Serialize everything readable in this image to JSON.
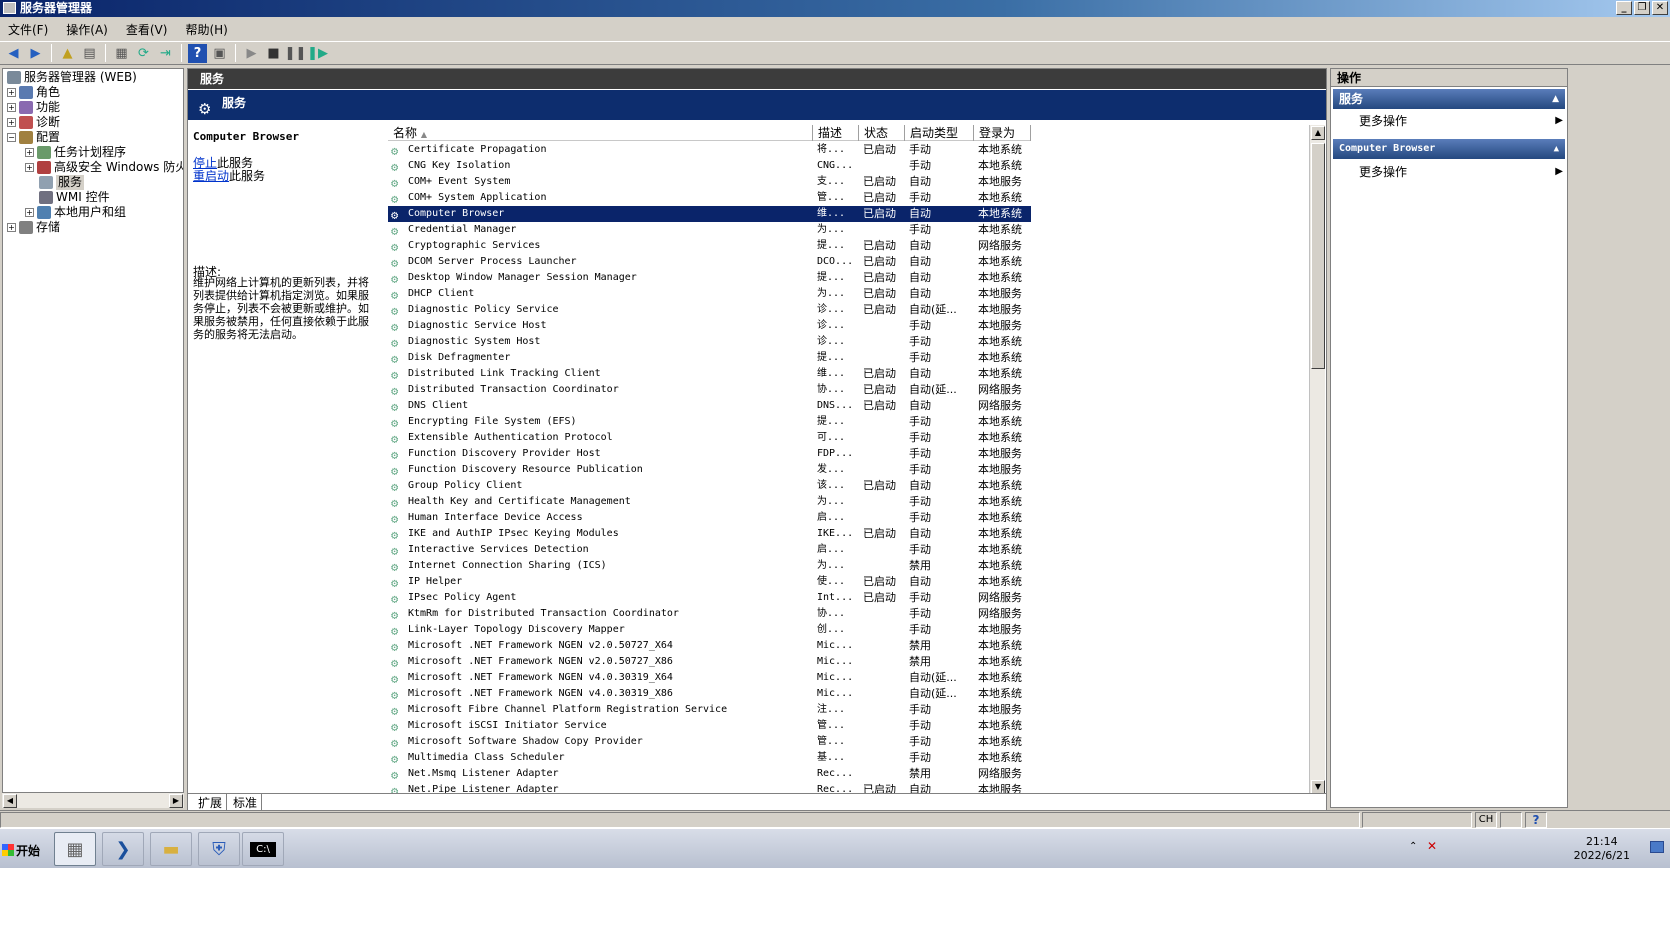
{
  "window": {
    "title": "服务器管理器",
    "buttons": [
      "_",
      "❐",
      "✕"
    ]
  },
  "menu": [
    "文件(F)",
    "操作(A)",
    "查看(V)",
    "帮助(H)"
  ],
  "tree": [
    {
      "label": "服务器管理器 (WEB)",
      "icon": "server-manager-icon",
      "level": 0,
      "expand": ""
    },
    {
      "label": "角色",
      "icon": "roles-icon",
      "level": 1,
      "expand": "+"
    },
    {
      "label": "功能",
      "icon": "features-icon",
      "level": 1,
      "expand": "+"
    },
    {
      "label": "诊断",
      "icon": "diagnostics-icon",
      "level": 1,
      "expand": "+"
    },
    {
      "label": "配置",
      "icon": "configuration-icon",
      "level": 1,
      "expand": "−"
    },
    {
      "label": "任务计划程序",
      "icon": "task-scheduler-icon",
      "level": 2,
      "expand": "+"
    },
    {
      "label": "高级安全 Windows 防火墙",
      "icon": "firewall-icon",
      "level": 2,
      "expand": "+"
    },
    {
      "label": "服务",
      "icon": "services-icon",
      "level": 2,
      "expand": ""
    },
    {
      "label": "WMI 控件",
      "icon": "wmi-icon",
      "level": 2,
      "expand": ""
    },
    {
      "label": "本地用户和组",
      "icon": "users-icon",
      "level": 2,
      "expand": "+"
    },
    {
      "label": "存储",
      "icon": "storage-icon",
      "level": 1,
      "expand": "+"
    }
  ],
  "center": {
    "header": "服务",
    "banner": "服务",
    "selected_service": "Computer Browser",
    "stop_link": "停止",
    "stop_suffix": "此服务",
    "restart_link": "重启动",
    "restart_suffix": "此服务",
    "desc_label": "描述:",
    "description": "维护网络上计算机的更新列表，并将列表提供给计算机指定浏览。如果服务停止，列表不会被更新或维护。如果服务被禁用，任何直接依赖于此服务的服务将无法启动。",
    "columns": [
      "名称",
      "描述",
      "状态",
      "启动类型",
      "登录为"
    ],
    "tabs": [
      "扩展",
      "标准"
    ]
  },
  "services": [
    [
      "Certificate Propagation",
      "将...",
      "已启动",
      "手动",
      "本地系统"
    ],
    [
      "CNG Key Isolation",
      "CNG...",
      "",
      "手动",
      "本地系统"
    ],
    [
      "COM+ Event System",
      "支...",
      "已启动",
      "自动",
      "本地服务"
    ],
    [
      "COM+ System Application",
      "管...",
      "已启动",
      "手动",
      "本地系统"
    ],
    [
      "Computer Browser",
      "维...",
      "已启动",
      "自动",
      "本地系统"
    ],
    [
      "Credential Manager",
      "为...",
      "",
      "手动",
      "本地系统"
    ],
    [
      "Cryptographic Services",
      "提...",
      "已启动",
      "自动",
      "网络服务"
    ],
    [
      "DCOM Server Process Launcher",
      "DCO...",
      "已启动",
      "自动",
      "本地系统"
    ],
    [
      "Desktop Window Manager Session Manager",
      "提...",
      "已启动",
      "自动",
      "本地系统"
    ],
    [
      "DHCP Client",
      "为...",
      "已启动",
      "自动",
      "本地服务"
    ],
    [
      "Diagnostic Policy Service",
      "诊...",
      "已启动",
      "自动(延...",
      "本地服务"
    ],
    [
      "Diagnostic Service Host",
      "诊...",
      "",
      "手动",
      "本地服务"
    ],
    [
      "Diagnostic System Host",
      "诊...",
      "",
      "手动",
      "本地系统"
    ],
    [
      "Disk Defragmenter",
      "提...",
      "",
      "手动",
      "本地系统"
    ],
    [
      "Distributed Link Tracking Client",
      "维...",
      "已启动",
      "自动",
      "本地系统"
    ],
    [
      "Distributed Transaction Coordinator",
      "协...",
      "已启动",
      "自动(延...",
      "网络服务"
    ],
    [
      "DNS Client",
      "DNS...",
      "已启动",
      "自动",
      "网络服务"
    ],
    [
      "Encrypting File System (EFS)",
      "提...",
      "",
      "手动",
      "本地系统"
    ],
    [
      "Extensible Authentication Protocol",
      "可...",
      "",
      "手动",
      "本地系统"
    ],
    [
      "Function Discovery Provider Host",
      "FDP...",
      "",
      "手动",
      "本地服务"
    ],
    [
      "Function Discovery Resource Publication",
      "发...",
      "",
      "手动",
      "本地服务"
    ],
    [
      "Group Policy Client",
      "该...",
      "已启动",
      "自动",
      "本地系统"
    ],
    [
      "Health Key and Certificate Management",
      "为...",
      "",
      "手动",
      "本地系统"
    ],
    [
      "Human Interface Device Access",
      "启...",
      "",
      "手动",
      "本地系统"
    ],
    [
      "IKE and AuthIP IPsec Keying Modules",
      "IKE...",
      "已启动",
      "自动",
      "本地系统"
    ],
    [
      "Interactive Services Detection",
      "启...",
      "",
      "手动",
      "本地系统"
    ],
    [
      "Internet Connection Sharing (ICS)",
      "为...",
      "",
      "禁用",
      "本地系统"
    ],
    [
      "IP Helper",
      "使...",
      "已启动",
      "自动",
      "本地系统"
    ],
    [
      "IPsec Policy Agent",
      "Int...",
      "已启动",
      "手动",
      "网络服务"
    ],
    [
      "KtmRm for Distributed Transaction Coordinator",
      "协...",
      "",
      "手动",
      "网络服务"
    ],
    [
      "Link-Layer Topology Discovery Mapper",
      "创...",
      "",
      "手动",
      "本地服务"
    ],
    [
      "Microsoft .NET Framework NGEN v2.0.50727_X64",
      "Mic...",
      "",
      "禁用",
      "本地系统"
    ],
    [
      "Microsoft .NET Framework NGEN v2.0.50727_X86",
      "Mic...",
      "",
      "禁用",
      "本地系统"
    ],
    [
      "Microsoft .NET Framework NGEN v4.0.30319_X64",
      "Mic...",
      "",
      "自动(延...",
      "本地系统"
    ],
    [
      "Microsoft .NET Framework NGEN v4.0.30319_X86",
      "Mic...",
      "",
      "自动(延...",
      "本地系统"
    ],
    [
      "Microsoft Fibre Channel Platform Registration Service",
      "注...",
      "",
      "手动",
      "本地服务"
    ],
    [
      "Microsoft iSCSI Initiator Service",
      "管...",
      "",
      "手动",
      "本地系统"
    ],
    [
      "Microsoft Software Shadow Copy Provider",
      "管...",
      "",
      "手动",
      "本地系统"
    ],
    [
      "Multimedia Class Scheduler",
      "基...",
      "",
      "手动",
      "本地系统"
    ],
    [
      "Net.Msmq Listener Adapter",
      "Rec...",
      "",
      "禁用",
      "网络服务"
    ],
    [
      "Net.Pipe Listener Adapter",
      "Rec...",
      "已启动",
      "自动",
      "本地服务"
    ]
  ],
  "selected_index": 4,
  "actions": {
    "header": "操作",
    "section1": "服务",
    "section1_item": "更多操作",
    "section2": "Computer Browser",
    "section2_item": "更多操作"
  },
  "status": {
    "lang": "CH"
  },
  "taskbar": {
    "start": "开始",
    "time": "21:14",
    "date": "2022/6/21"
  }
}
